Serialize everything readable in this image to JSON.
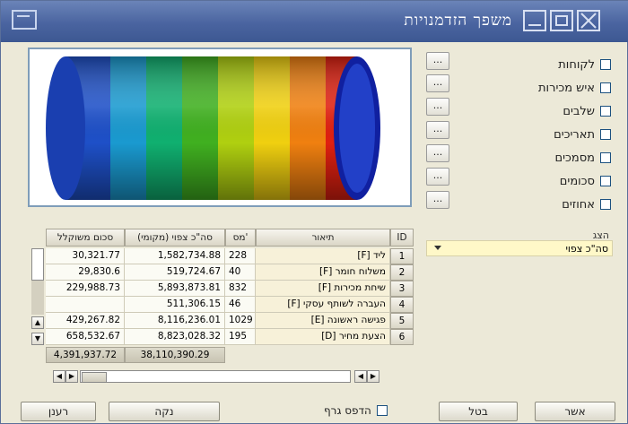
{
  "window": {
    "title": "משפך הזדמנויות"
  },
  "filters": [
    {
      "label": "לקוחות"
    },
    {
      "label": "איש מכירות"
    },
    {
      "label": "שלבים"
    },
    {
      "label": "תאריכים"
    },
    {
      "label": "מסמכים"
    },
    {
      "label": "סכומים"
    },
    {
      "label": "אחוזים"
    }
  ],
  "ellipsis_label": "...",
  "display": {
    "label": "הצג",
    "selected": "סה\"כ צפוי"
  },
  "table": {
    "headers": {
      "id": "ID",
      "desc": "תיאור",
      "num": "מס'",
      "expected": "סה\"כ צפוי (מקומי)",
      "weighted": "סכום משוקלל"
    },
    "rows": [
      {
        "id": "1",
        "desc": "ליד [F]",
        "num": "228",
        "expected": "1,582,734.88",
        "weighted": "30,321.77"
      },
      {
        "id": "2",
        "desc": "משלוח חומר [F]",
        "num": "40",
        "expected": "519,724.67",
        "weighted": "29,830.6"
      },
      {
        "id": "3",
        "desc": "שיחת מכירות [F]",
        "num": "832",
        "expected": "5,893,873.81",
        "weighted": "229,988.73"
      },
      {
        "id": "4",
        "desc": "העברה לשותף עסקי [F]",
        "num": "46",
        "expected": "511,306.15",
        "weighted": ""
      },
      {
        "id": "5",
        "desc": "פגישה ראשונה [E]",
        "num": "1029",
        "expected": "8,116,236.01",
        "weighted": "429,267.82"
      },
      {
        "id": "6",
        "desc": "הצעת מחיר [D]",
        "num": "195",
        "expected": "8,823,028.32",
        "weighted": "658,532.67"
      }
    ],
    "totals": {
      "expected": "38,110,390.29",
      "weighted": "4,391,937.72"
    }
  },
  "buttons": {
    "ok": "אשר",
    "cancel": "בטל",
    "clear": "נקה",
    "refresh": "רענן",
    "print": "הדפס גרף"
  },
  "colors": {
    "title_bar": "#4a64a0",
    "combo_bg": "#fff8c8",
    "window_bg": "#ece9d8"
  }
}
